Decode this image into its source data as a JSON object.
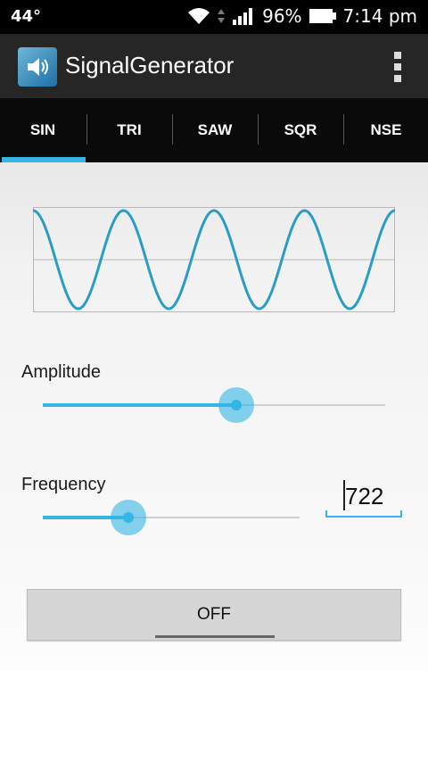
{
  "status_bar": {
    "temperature": "44°",
    "battery": "96%",
    "time": "7:14 pm"
  },
  "action_bar": {
    "title": "SignalGenerator",
    "app_icon": "speaker-icon",
    "overflow_icon": "overflow-menu-icon"
  },
  "tabs": [
    {
      "label": "SIN",
      "active": true
    },
    {
      "label": "TRI",
      "active": false
    },
    {
      "label": "SAW",
      "active": false
    },
    {
      "label": "SQR",
      "active": false
    },
    {
      "label": "NSE",
      "active": false
    }
  ],
  "waveform": {
    "type": "sine",
    "cycles": 4
  },
  "amplitude": {
    "label": "Amplitude",
    "value_fraction": 0.566
  },
  "frequency": {
    "label": "Frequency",
    "value_fraction": 0.333,
    "input_value": "722"
  },
  "toggle": {
    "label": "OFF"
  },
  "colors": {
    "accent": "#33b5e5",
    "wave": "#2a9dc7",
    "action_bar": "#262626",
    "tab_bar": "#0a0a0a"
  }
}
